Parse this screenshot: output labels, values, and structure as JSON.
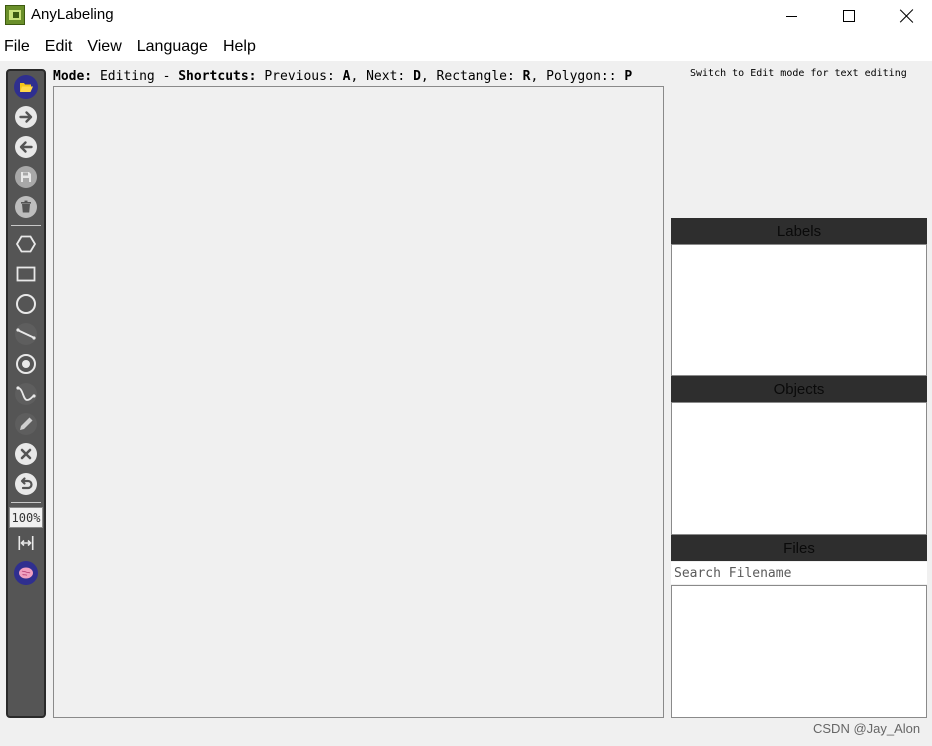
{
  "window": {
    "title": "AnyLabeling",
    "controls": [
      "minimize-icon",
      "maximize-icon",
      "close-icon"
    ]
  },
  "menu": [
    "File",
    "Edit",
    "View",
    "Language",
    "Help"
  ],
  "toolbar": {
    "tools": [
      {
        "name": "open",
        "icon": "folder-open-icon"
      },
      {
        "name": "next-image",
        "icon": "arrow-right-icon"
      },
      {
        "name": "prev-image",
        "icon": "arrow-left-icon"
      },
      {
        "name": "save",
        "icon": "save-icon"
      },
      {
        "name": "delete-file",
        "icon": "trash-icon"
      },
      {
        "name": "create-polygon",
        "icon": "polygon-icon"
      },
      {
        "name": "create-rectangle",
        "icon": "rectangle-icon"
      },
      {
        "name": "create-circle",
        "icon": "circle-icon"
      },
      {
        "name": "create-line",
        "icon": "line-icon"
      },
      {
        "name": "create-point",
        "icon": "point-icon"
      },
      {
        "name": "create-linestrip",
        "icon": "linestrip-icon"
      },
      {
        "name": "edit-shapes",
        "icon": "pencil-icon"
      },
      {
        "name": "delete-shapes",
        "icon": "delete-x-icon"
      },
      {
        "name": "undo",
        "icon": "undo-icon"
      },
      {
        "name": "fit-width",
        "icon": "fit-width-icon"
      },
      {
        "name": "auto-labeling",
        "icon": "brain-icon"
      }
    ],
    "zoom_value": "100%"
  },
  "mode_bar": {
    "mode_label": "Mode:",
    "mode_value": " Editing - ",
    "shortcuts_label": "Shortcuts:",
    "previous_label": " Previous: ",
    "previous_key": "A",
    "next_label": ", Next: ",
    "next_key": "D",
    "rectangle_label": ", Rectangle: ",
    "rectangle_key": "R",
    "polygon_label": ", Polygon:: ",
    "polygon_key": "P"
  },
  "switch_hint": "Switch to Edit mode for text editing",
  "docks": {
    "labels_title": "Labels",
    "objects_title": "Objects",
    "files_title": "Files",
    "files_search_placeholder": "Search Filename"
  },
  "watermark": "CSDN @Jay_Alon",
  "colors": {
    "toolbar_bg": "#555555",
    "dock_title_bg": "#2e2e2e",
    "tool_icon": "#e8e8e8",
    "brand_icon_blue": "#2f2f8f",
    "folder_yellow": "#f5c518"
  }
}
